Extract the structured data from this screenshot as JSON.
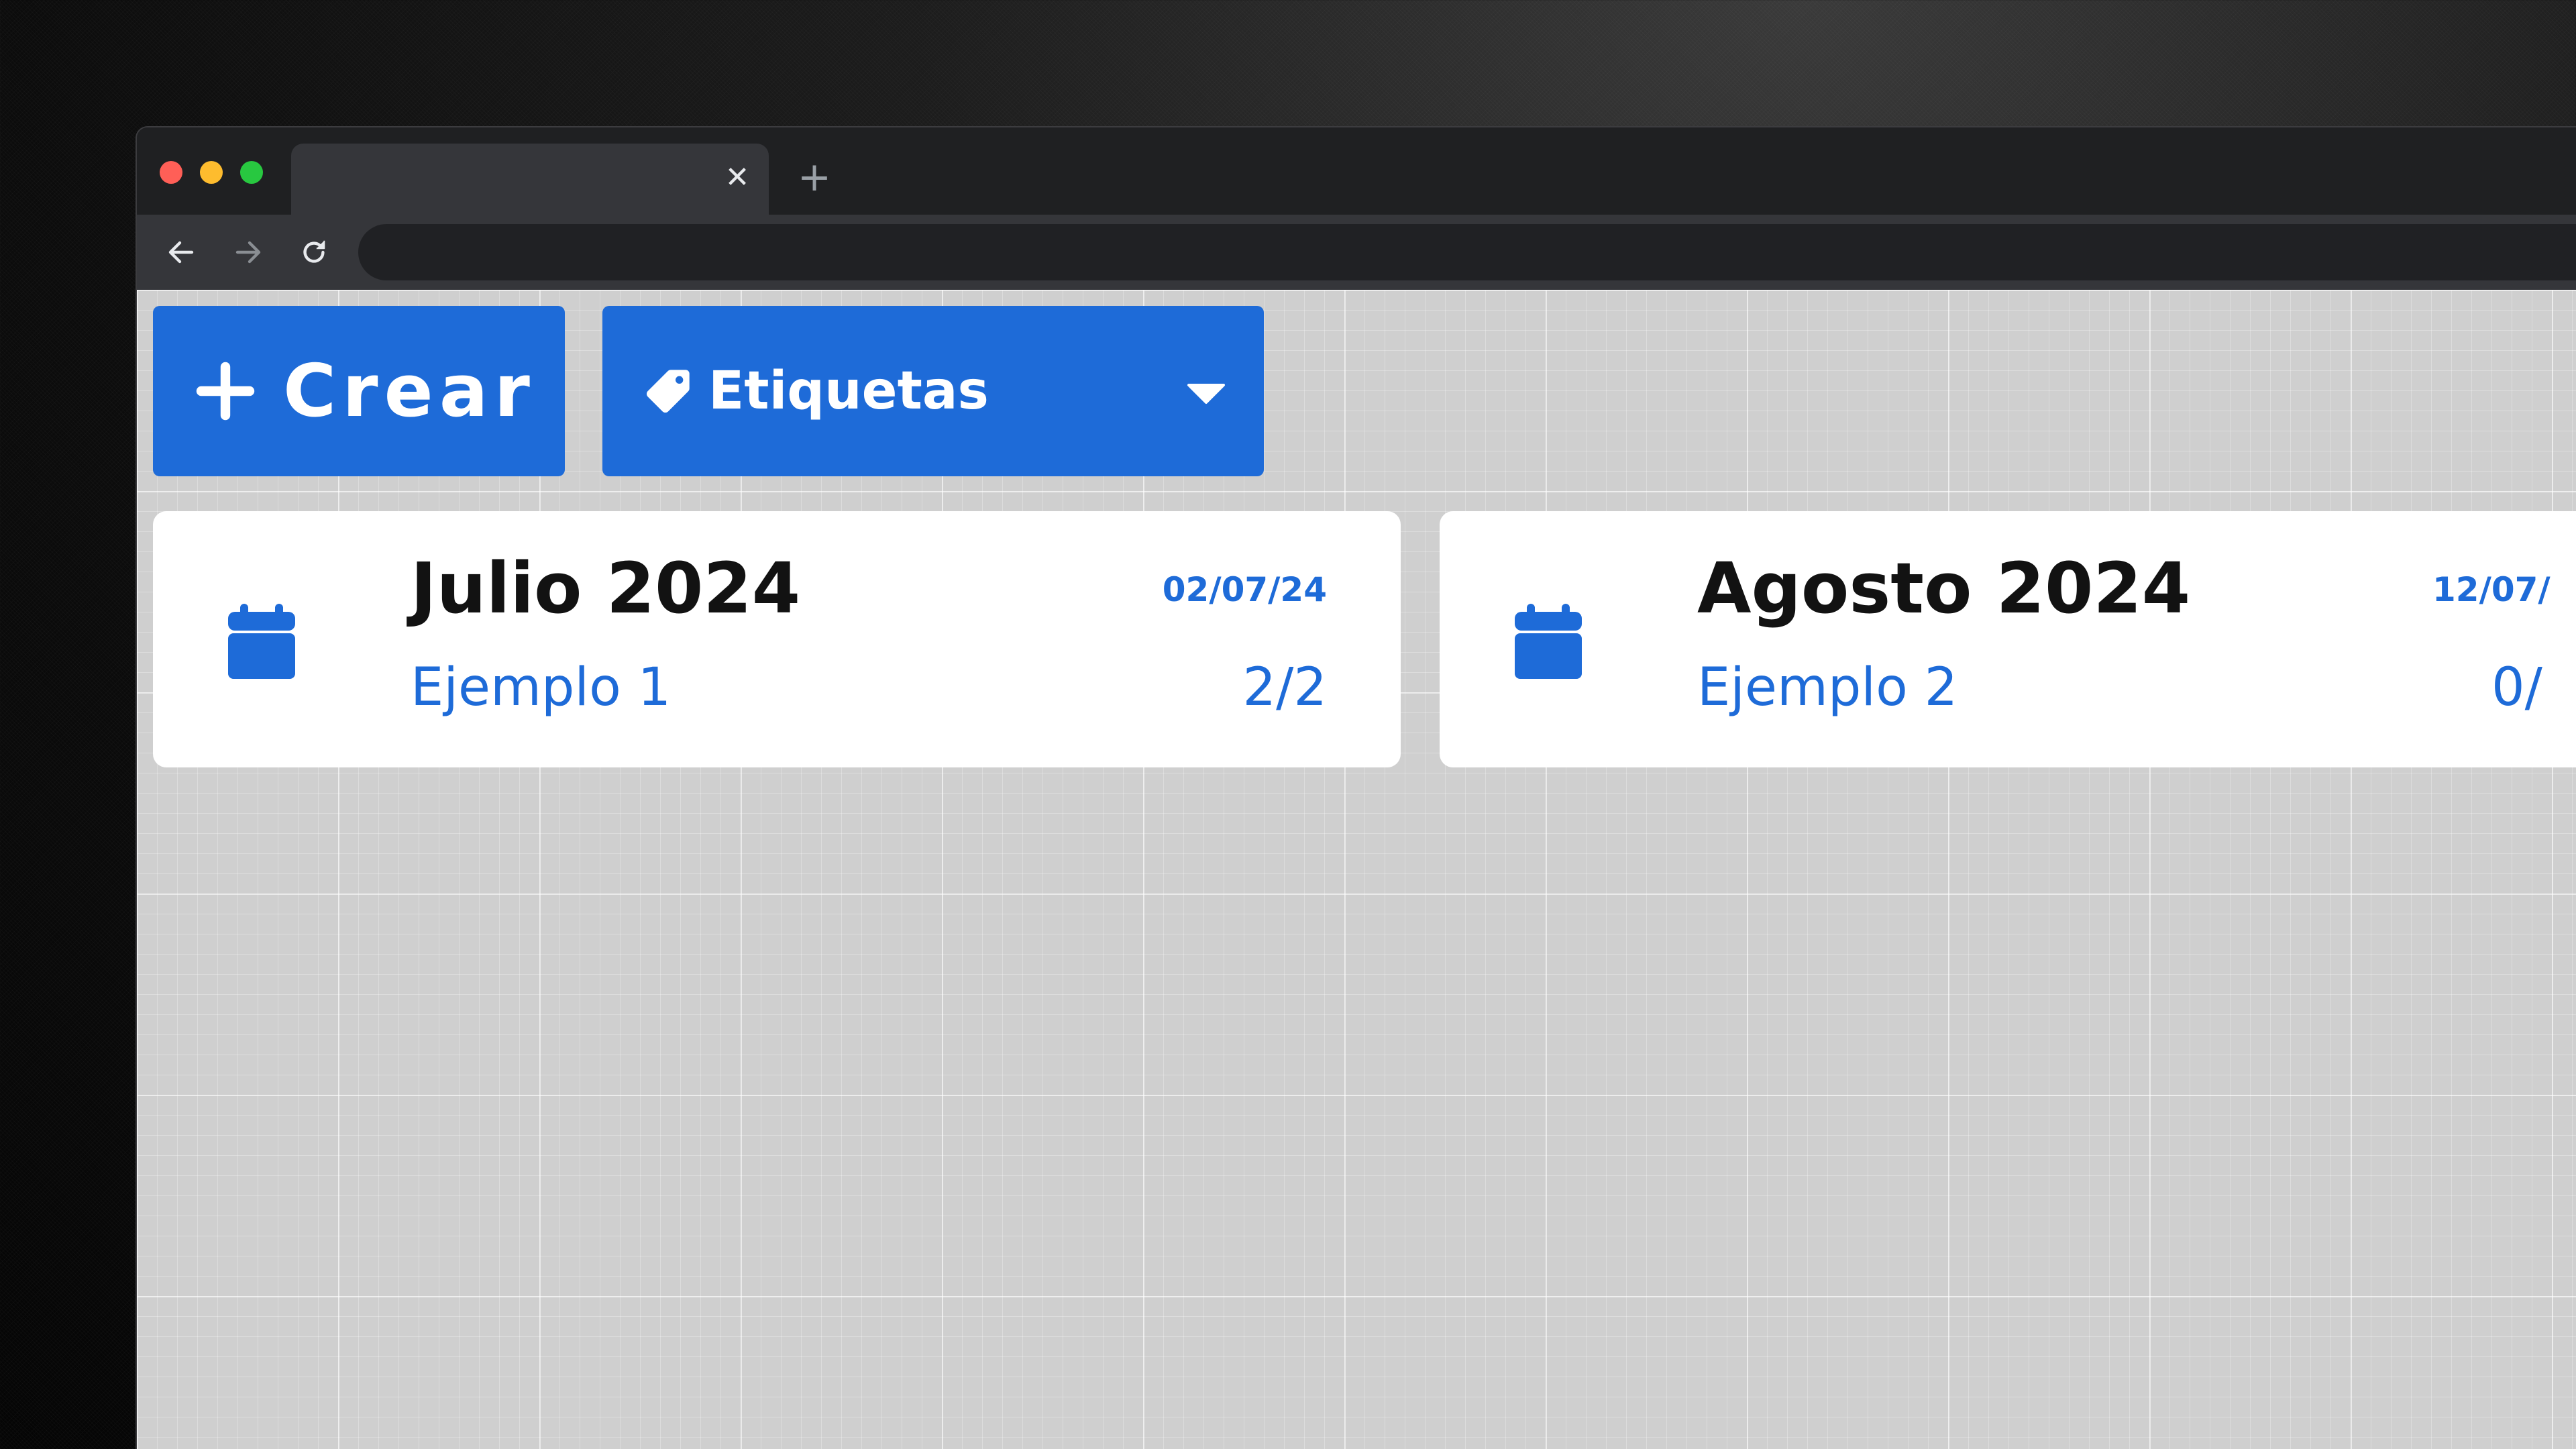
{
  "toolbar": {
    "create_label": "Crear",
    "tags_label": "Etiquetas"
  },
  "cards": [
    {
      "title": "Julio 2024",
      "date": "02/07/24",
      "subtitle": "Ejemplo 1",
      "count": "2/2"
    },
    {
      "title": "Agosto 2024",
      "date": "12/07/",
      "subtitle": "Ejemplo 2",
      "count": "0/"
    }
  ],
  "icons": {
    "create": "plus-icon",
    "tags": "tag-icon",
    "dropdown": "caret-down-icon",
    "card": "calendar-icon"
  },
  "colors": {
    "accent": "#1e6bd8",
    "card_background": "#ffffff",
    "title_text": "#121212",
    "canvas": "#cfcfcf"
  }
}
